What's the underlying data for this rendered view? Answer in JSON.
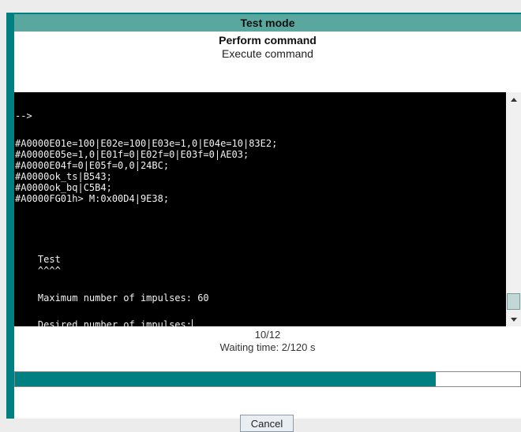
{
  "window": {
    "title": "Test mode"
  },
  "header": {
    "heading": "Perform command",
    "subheading": "Execute command"
  },
  "console": {
    "lines": [
      "-->",
      "#A0000E01e=100|E02e=100|E03e=1,0|E04e=10|83E2;",
      "#A0000E05e=1,0|E01f=0|E02f=0|E03f=0|AE03;",
      "#A0000E04f=0|E05f=0,0|24BC;",
      "#A0000ok_ts|B543;",
      "#A0000ok_bq|C5B4;",
      "#A0000FG01h> M:0x00D4|9E38;",
      "    Test",
      "    ^^^^",
      "    Maximum number of impulses: 60",
      "    Desired number of impulses:"
    ]
  },
  "scrollbar": {
    "up_icon": "triangle-up-icon",
    "down_icon": "triangle-down-icon"
  },
  "progress": {
    "count": "10/12",
    "waiting": "Waiting time: 2/120 s",
    "fraction": 0.8333,
    "color": "#008080"
  },
  "actions": {
    "cancel_label": "Cancel"
  }
}
